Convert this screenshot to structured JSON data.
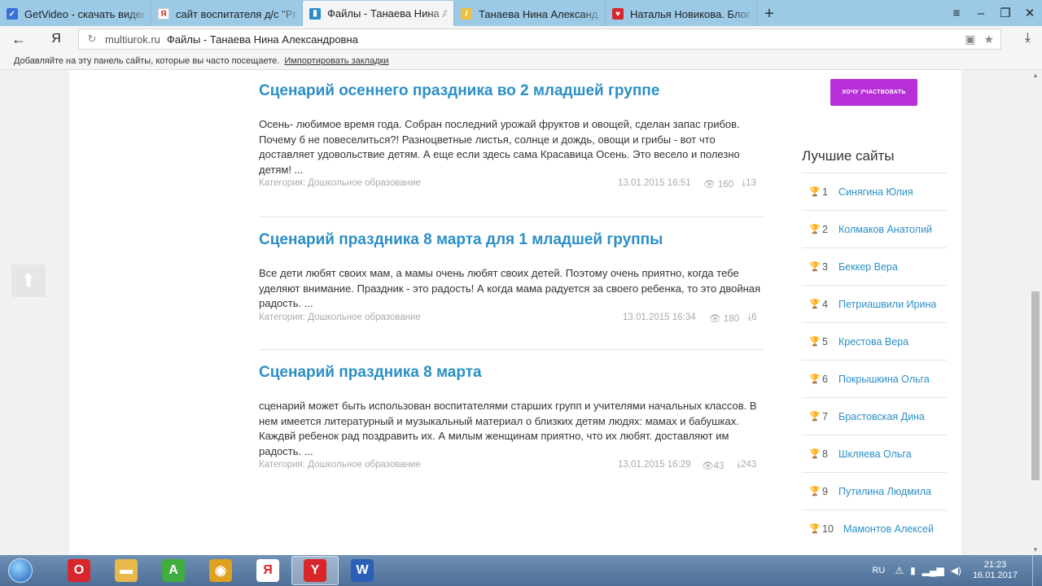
{
  "tabs": [
    {
      "title": "GetVideo - скачать видео с",
      "icon": "getvideo-icon",
      "color": "#3a6fd8",
      "glyph": "✓",
      "active": false
    },
    {
      "title": "сайт воспитателя д/с \"Рябин",
      "icon": "yandex-icon",
      "color": "#ffffff",
      "glyph": "Я",
      "active": false
    },
    {
      "title": "Файлы - Танаева Нина А",
      "icon": "book-icon",
      "color": "#2a8fc6",
      "glyph": "▮",
      "active": true
    },
    {
      "title": "Танаева Нина Александров",
      "icon": "pencil-icon",
      "color": "#f0c040",
      "glyph": "/",
      "active": false
    },
    {
      "title": "Наталья Новикова. Блог - С",
      "icon": "heart-icon",
      "color": "#d8262b",
      "glyph": "♥",
      "active": false
    }
  ],
  "address": {
    "domain": "multiurok.ru",
    "title": "Файлы - Танаева Нина Александровна"
  },
  "bookmarks": {
    "hint": "Добавляйте на эту панель сайты, которые вы часто посещаете.",
    "import": "Импортировать закладки"
  },
  "articles": [
    {
      "title": "Сценарий осеннего праздника во 2 младшей группе",
      "text": "Осень- любимое время года. Собран последний урожай фруктов и овощей, сделан запас грибов. Почему б не повеселиться?!  Разноцветные листья, солнце и дождь, овощи и грибы - вот что доставляет удовольствие детям. А еще если здесь сама Красавица Осень. Это весело и полезно детям! ...",
      "category": "Категория: Дошкольное образование",
      "date": "13.01.2015 16:51",
      "views": "160",
      "downloads": "13"
    },
    {
      "title": "Сценарий праздника 8 марта для 1 младшей группы",
      "text": "Все  дети любят своих мам, а мамы очень любят своих детей. Поэтому очень приятно, когда тебе уделяют внимание. Праздник - это радость! А когда мама радуется за своего ребенка, то это двойная радость. ...",
      "category": "Категория: Дошкольное образование",
      "date": "13.01.2015 16:34",
      "views": "180",
      "downloads": "6"
    },
    {
      "title": "Сценарий праздника 8 марта",
      "text": "сценарий может быть использован воспитателями старших групп и учителями начальных классов. В нем имеется литературный и музыкальный материал о близких детям людях: мамах и бабушках. Каждвй ребенок рад поздравить их. А милым женщинам приятно, что их любят. доставляют им радость. ...",
      "category": "Категория: Дошкольное образование",
      "date": "13.01.2015 16:29",
      "views": "43",
      "downloads": "243"
    }
  ],
  "sidebar": {
    "join_button": "ХОЧУ УЧАСТВОВАТЬ",
    "best_title": "Лучшие сайты",
    "best_sites": [
      {
        "rank": "1",
        "name": "Синягина Юлия"
      },
      {
        "rank": "2",
        "name": "Колмаков Анатолий"
      },
      {
        "rank": "3",
        "name": "Беккер Вера"
      },
      {
        "rank": "4",
        "name": "Петриашвили Ирина"
      },
      {
        "rank": "5",
        "name": "Крестова Вера"
      },
      {
        "rank": "6",
        "name": "Покрышкина Ольга"
      },
      {
        "rank": "7",
        "name": "Брастовская Дина"
      },
      {
        "rank": "8",
        "name": "Шкляева Ольга"
      },
      {
        "rank": "9",
        "name": "Путилина Людмила"
      },
      {
        "rank": "10",
        "name": "Мамонтов Алексей"
      }
    ]
  },
  "taskbar": {
    "apps": [
      {
        "name": "opera-icon",
        "color": "#d8262b",
        "glyph": "O",
        "active": false
      },
      {
        "name": "folder-icon",
        "color": "#e8b84a",
        "glyph": "▬",
        "active": false
      },
      {
        "name": "vkontakte-icon",
        "color": "#3fae3f",
        "glyph": "A",
        "active": false
      },
      {
        "name": "chrome-icon",
        "color": "#e0a020",
        "glyph": "◉",
        "active": false
      },
      {
        "name": "yandex-icon",
        "color": "#ffffff",
        "glyph": "Я",
        "active": false
      },
      {
        "name": "yandex-browser-icon",
        "color": "#d8262b",
        "glyph": "Y",
        "active": true
      },
      {
        "name": "word-icon",
        "color": "#2b5fb5",
        "glyph": "W",
        "active": false
      }
    ],
    "lang": "RU",
    "time": "21:23",
    "date": "16.01.2017"
  }
}
